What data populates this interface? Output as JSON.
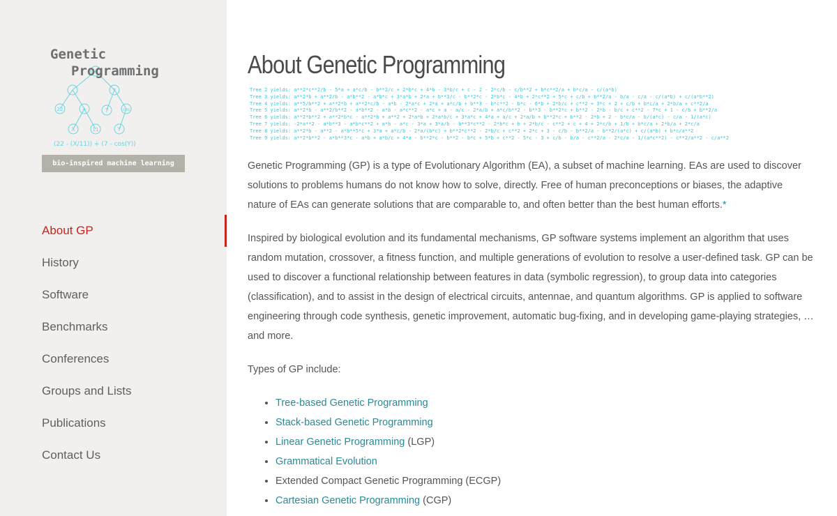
{
  "logo": {
    "title_line1": "Genetic",
    "title_line2": "Programming",
    "tagline": "bio-inspired machine learning",
    "formula": "(22 - (X/11)) + (7 - cos(Y))",
    "tree_nodes": [
      "+",
      "-",
      "*",
      "22",
      "÷",
      "7",
      "cos",
      "X",
      "11",
      "Y"
    ]
  },
  "nav": {
    "items": [
      {
        "label": "About GP",
        "active": true
      },
      {
        "label": "History"
      },
      {
        "label": "Software"
      },
      {
        "label": "Benchmarks"
      },
      {
        "label": "Conferences"
      },
      {
        "label": "Groups and Lists"
      },
      {
        "label": "Publications"
      },
      {
        "label": "Contact Us"
      }
    ]
  },
  "main": {
    "title": "About Genetic Programming",
    "yields": [
      "Tree 2 yields: a**2*c**2/b - 5*a + a*c/b - b**2/c + 2*b*c + 4*b - 3*b/c + c - 2 - 2*c/b - c/b**2 + b*c**2/a + b*c/a - c/(a*b)",
      "Tree 3 yields: a**2*b + a**2/b - a*b**2 - a*b*c + 3*a*b + 2*a + b**3/c - b**2*c - 2*b*c - 4*b + 2*c**2 + 5*c + c/b + b**2/a - b/a - c/a - c/(a*b) + c/(a*b**2)",
      "Tree 4 yields: a**5/b**2 + a**2*b + a**2*c/b - a*b - 2*a*c + 2*a + a*c/b + b**3 - b*c**2 - b*c - 6*b + 2*b/c + c**2 + 3*c + 2 + c/b + b*c/a + 2*b/a + c**2/a",
      "Tree 5 yields: a**2*b - a**2/b**2 - a*b**2 - a*b - a*c**2 - a*c + a - a/c - 2*a/b + a*c/b**2 - b**3 - b**2*c + b**2 - 2*b - b/c + c**2 - 7*c + 1 - c/b + b**2/a",
      "Tree 6 yields: a**2*b**2 + a**2*b*c - a**2*b + a**2 + 2*a*b + 2*a*b/c + 3*a*c + 4*a + a/c + 2*a/b + b**2*c + b**2 - 2*b + 2 - b*c/a - b/(a*c) - c/a - 1/(a*c)",
      "Tree 7 yields: -2*a**2 - a*b**3 - a*b*c**2 + a*b - a*c - 3*a + 3*a/b - b**3*c**2 - 2*b*c + b + 2*b/c - c**2 + c + 4 + 2*c/b + 1/b + b*c/a + 2*b/a + 2*c/a",
      "Tree 8 yields: a**2*b - a**2 - a*b**5*c + 3*a + a*c/b - 2*a/(b*c) + b**2*c**2 - 2*b/c + c**2 + 2*c + 3 - c/b - b**2/a - b**2/(a*c) + c/(a*b) + b*c/a**2",
      "Tree 9 yields: a**2*b**2 - a*b**3*c - a*b + a*b/c + 4*a - b**2*c - b**2 - b*c + 5*b + c**2 - 5*c - 3 + c/b - b/a - c**2/a - 2*c/a - 1/(a*c**2) - c**2/a**2 - c/a**2"
    ],
    "para1_text": "Genetic Programming (GP) is a type of Evolutionary Algorithm (EA), a subset of machine learning. EAs are used to discover solutions to problems humans do not know how to solve, directly. Free of human preconceptions or biases, the adaptive nature of EAs can generate solutions that are comparable to, and often better than the best human efforts.",
    "para1_link": "*",
    "para2_text": "Inspired by biological evolution and its fundamental mechanisms, GP software systems implement an algorithm that uses random mutation, crossover, a fitness function, and multiple generations of evolution to resolve a user-defined task. GP can be used to discover a functional relationship between features in data (symbolic regression), to group data into categories (classification), and to assist in the design of electrical circuits, antennae, and quantum algorithms. GP is applied to software engineering through code synthesis, genetic improvement, automatic bug-fixing, and in developing game-playing strategies, … and more.",
    "types_intro": "Types of GP include:",
    "types": [
      {
        "link": "Tree-based Genetic Programming",
        "suffix": ""
      },
      {
        "link": "Stack-based Genetic Programming",
        "suffix": ""
      },
      {
        "link": "Linear Genetic Programming",
        "suffix": " (LGP)"
      },
      {
        "link": "Grammatical Evolution",
        "suffix": ""
      },
      {
        "text": "Extended Compact Genetic Programming (ECGP)"
      },
      {
        "link": "Cartesian Genetic Programming",
        "suffix": " (CGP)"
      }
    ]
  },
  "colors": {
    "accent": "#c7231f",
    "link": "#2a8a99",
    "yields": "#3bc6d6",
    "sidebar_bg": "#f1f0ee"
  }
}
